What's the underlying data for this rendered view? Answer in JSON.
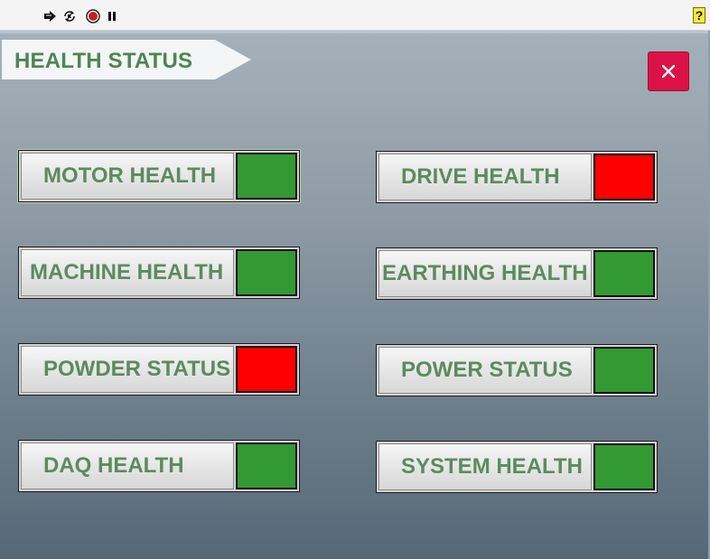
{
  "toolbar": {
    "buttons": [
      {
        "icon": "run-arrow-icon"
      },
      {
        "icon": "run-continuously-icon"
      },
      {
        "icon": "abort-stop-icon"
      },
      {
        "icon": "pause-icon"
      }
    ],
    "help_icon": "context-help-icon"
  },
  "panel": {
    "title": "HEALTH STATUS",
    "close_icon": "close-icon",
    "close_color": "#db1248"
  },
  "colors": {
    "ok": "#339933",
    "fault": "#ff0000",
    "label_text": "#5b8b5e"
  },
  "status_items": [
    {
      "label": "MOTOR HEALTH",
      "state": "ok"
    },
    {
      "label": "DRIVE HEALTH",
      "state": "fault"
    },
    {
      "label": "MACHINE HEALTH",
      "state": "ok"
    },
    {
      "label": "EARTHING HEALTH",
      "state": "ok"
    },
    {
      "label": "POWDER STATUS",
      "state": "fault"
    },
    {
      "label": "POWER STATUS",
      "state": "ok"
    },
    {
      "label": "DAQ HEALTH",
      "state": "ok"
    },
    {
      "label": "SYSTEM HEALTH",
      "state": "ok"
    }
  ]
}
